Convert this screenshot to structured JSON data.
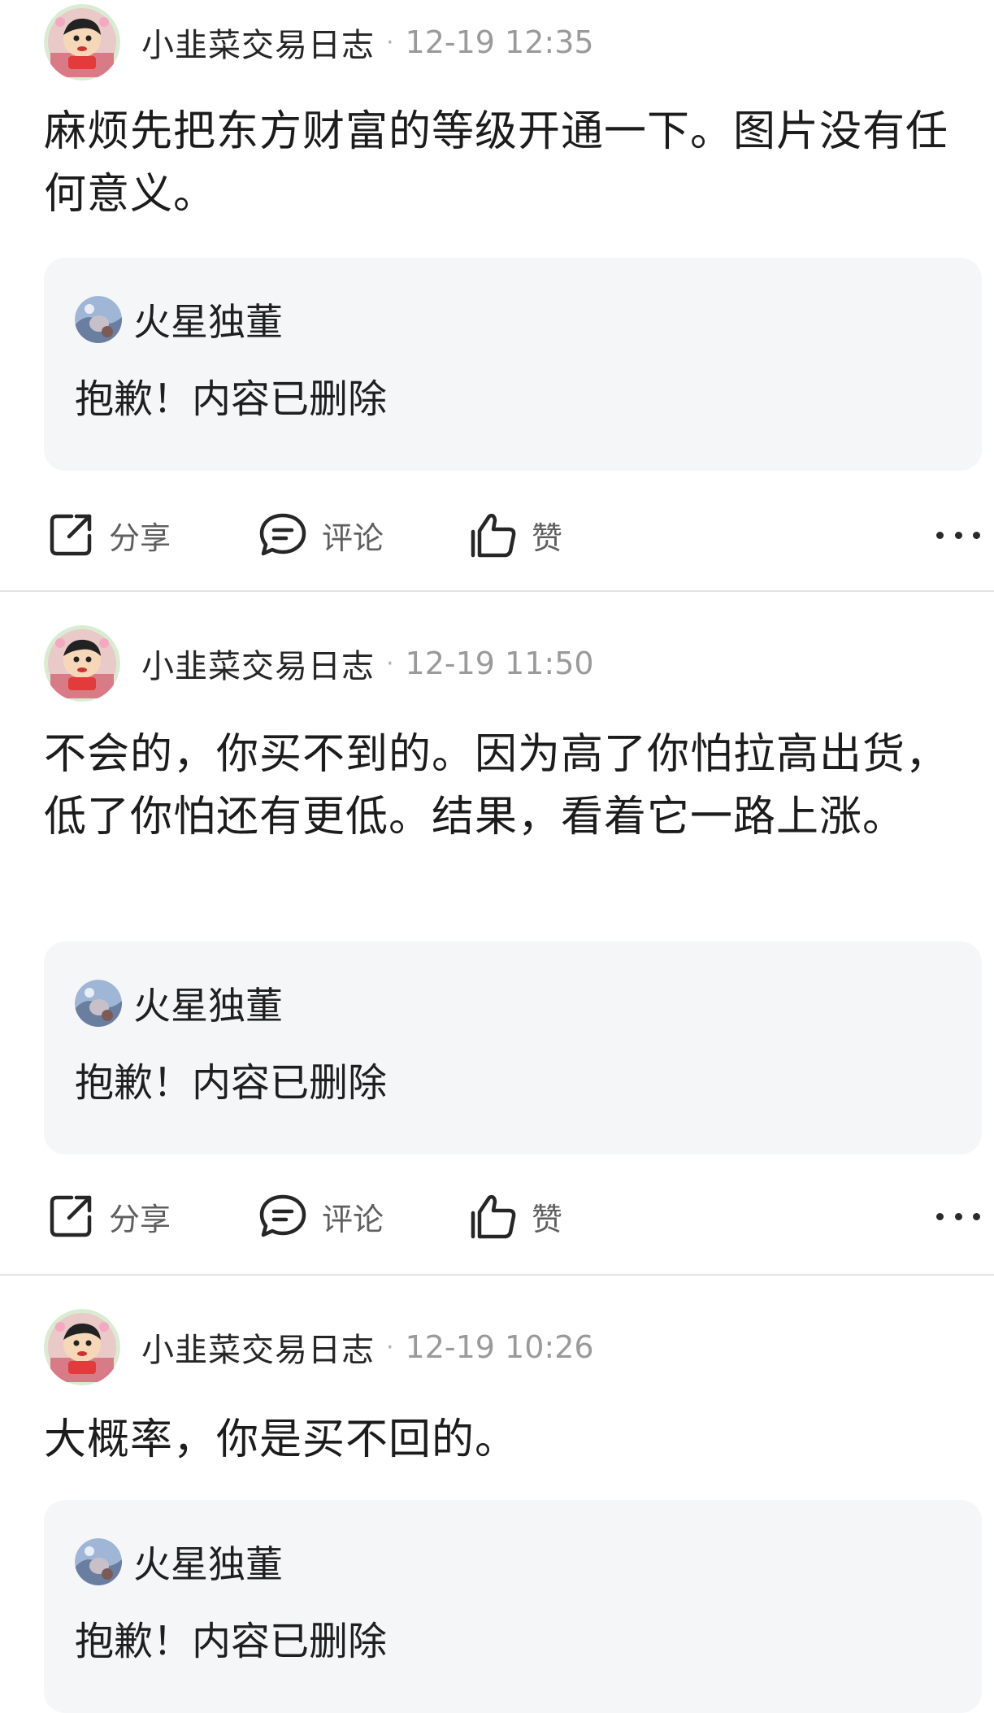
{
  "posts": [
    {
      "author": "小韭菜交易日志",
      "separator": "·",
      "time": "12-19 12:35",
      "text": "麻烦先把东方财富的等级开通一下。图片没有任何意义。",
      "quote": {
        "author": "火星独董",
        "text": "抱歉！内容已删除"
      },
      "actions": {
        "share": "分享",
        "comment": "评论",
        "like": "赞"
      }
    },
    {
      "author": "小韭菜交易日志",
      "separator": "·",
      "time": "12-19 11:50",
      "text": "不会的，你买不到的。因为高了你怕拉高出货，低了你怕还有更低。结果，看着它一路上涨。",
      "quote": {
        "author": "火星独董",
        "text": "抱歉！内容已删除"
      },
      "actions": {
        "share": "分享",
        "comment": "评论",
        "like": "赞"
      }
    },
    {
      "author": "小韭菜交易日志",
      "separator": "·",
      "time": "12-19 10:26",
      "text": "大概率，你是买不回的。",
      "quote": {
        "author": "火星独董",
        "text": "抱歉！内容已删除"
      }
    }
  ],
  "icons": {
    "share": "share-icon",
    "comment": "comment-icon",
    "like": "thumbs-up-icon",
    "more": "more-icon"
  },
  "colors": {
    "quote_background": "#f5f6f8",
    "divider": "#e2e2e2",
    "muted_text": "#9a9a9a"
  }
}
